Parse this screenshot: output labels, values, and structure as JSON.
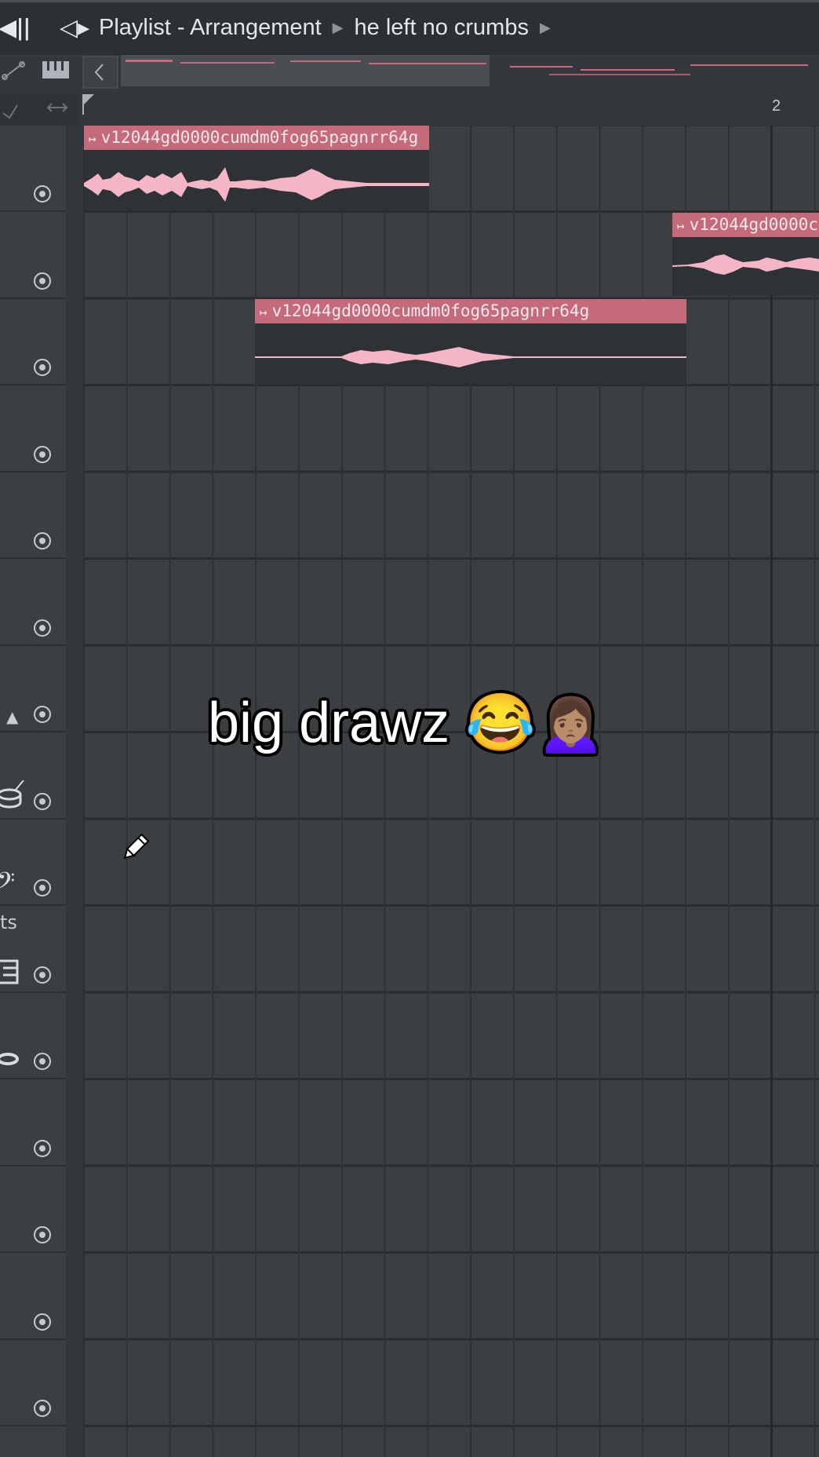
{
  "titlebar": {
    "speaker_icon": "speaker-icon",
    "title": "Playlist - Arrangement",
    "project": "he left no crumbs",
    "separator_icon": "triangle-right-icon"
  },
  "ruler": {
    "bar_2_label": "2"
  },
  "clips": [
    {
      "label": "v12044gd0000cumdm0fog65pagnrr64g"
    },
    {
      "label": "v12044gd0000c"
    },
    {
      "label": "v12044gd0000cumdm0fog65pagnrr64g"
    }
  ],
  "sidebar": {
    "partial_label": "ts"
  },
  "caption": {
    "text": "big drawz 😂🙍🏽‍♀️"
  },
  "colors": {
    "clip_header": "#c56a7b",
    "waveform": "#f4b6c6",
    "grid_bg": "#3c3f42"
  }
}
